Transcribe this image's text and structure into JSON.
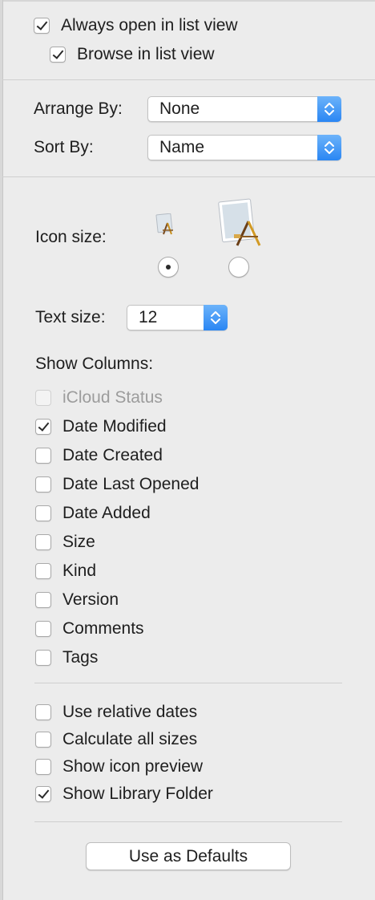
{
  "view_options": {
    "always_open_list": {
      "label": "Always open in list view",
      "checked": true
    },
    "browse_list": {
      "label": "Browse in list view",
      "checked": true
    },
    "arrange_by": {
      "label": "Arrange By:",
      "value": "None"
    },
    "sort_by": {
      "label": "Sort By:",
      "value": "Name"
    },
    "icon_size": {
      "label": "Icon size:",
      "selected": "small"
    },
    "text_size": {
      "label": "Text size:",
      "value": "12"
    },
    "show_columns": {
      "label": "Show Columns:",
      "items": [
        {
          "label": "iCloud Status",
          "checked": false,
          "enabled": false
        },
        {
          "label": "Date Modified",
          "checked": true,
          "enabled": true
        },
        {
          "label": "Date Created",
          "checked": false,
          "enabled": true
        },
        {
          "label": "Date Last Opened",
          "checked": false,
          "enabled": true
        },
        {
          "label": "Date Added",
          "checked": false,
          "enabled": true
        },
        {
          "label": "Size",
          "checked": false,
          "enabled": true
        },
        {
          "label": "Kind",
          "checked": false,
          "enabled": true
        },
        {
          "label": "Version",
          "checked": false,
          "enabled": true
        },
        {
          "label": "Comments",
          "checked": false,
          "enabled": true
        },
        {
          "label": "Tags",
          "checked": false,
          "enabled": true
        }
      ]
    },
    "options": [
      {
        "label": "Use relative dates",
        "checked": false
      },
      {
        "label": "Calculate all sizes",
        "checked": false
      },
      {
        "label": "Show icon preview",
        "checked": false
      },
      {
        "label": "Show Library Folder",
        "checked": true
      }
    ],
    "defaults_button": "Use as Defaults"
  },
  "colors": {
    "background": "#ececec",
    "accent": "#2a86f3"
  },
  "icons": [
    "app-icon-small",
    "app-icon-large",
    "popup-arrows-icon",
    "checkmark-icon"
  ]
}
